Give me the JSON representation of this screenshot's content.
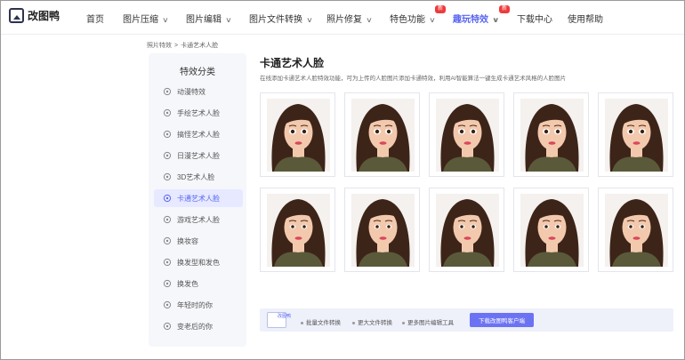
{
  "app": {
    "logo_text": "改图鸭"
  },
  "nav": {
    "home": "首页",
    "compress": "图片压缩",
    "edit": "图片编辑",
    "convert": "图片文件转换",
    "repair": "照片修复",
    "special": "特色功能",
    "fun": "趣玩特效",
    "download": "下载中心",
    "help": "使用帮助",
    "new_badge": "新"
  },
  "breadcrumb": {
    "parent": "照片特效",
    "separator": ">",
    "current": "卡通艺术人脸"
  },
  "sidebar": {
    "title": "特效分类",
    "items": [
      {
        "label": "动漫特效",
        "icon": "anime-icon"
      },
      {
        "label": "手绘艺术人脸",
        "icon": "sketch-face-icon"
      },
      {
        "label": "搞怪艺术人脸",
        "icon": "funny-face-icon"
      },
      {
        "label": "日漫艺术人脸",
        "icon": "japanese-anime-icon"
      },
      {
        "label": "3D艺术人脸",
        "icon": "3d-face-icon"
      },
      {
        "label": "卡通艺术人脸",
        "icon": "cartoon-face-icon",
        "active": true
      },
      {
        "label": "游戏艺术人脸",
        "icon": "game-face-icon"
      },
      {
        "label": "换妆容",
        "icon": "makeup-icon"
      },
      {
        "label": "换发型和发色",
        "icon": "hairstyle-icon"
      },
      {
        "label": "换发色",
        "icon": "hair-color-icon"
      },
      {
        "label": "年轻时的你",
        "icon": "younger-icon"
      },
      {
        "label": "变老后的你",
        "icon": "older-icon"
      }
    ]
  },
  "main": {
    "title": "卡通艺术人脸",
    "description": "在线添加卡通艺术人脸特效功能，可为上传的人脸图片添加卡通特效，利用AI智能算法一键生成卡通艺术风格的人脸图片"
  },
  "bottom_bar": {
    "icon_label": "改图鸭",
    "items": [
      "批量文件转换",
      "更大文件转换",
      "更多图片编辑工具"
    ],
    "button": "下载改图鸭客户端"
  },
  "colors": {
    "accent": "#5865f2",
    "badge": "#ef3a3a",
    "sidebar_bg": "#f6f7fb",
    "hair": "#3d2419",
    "skin": "#f3c9ae"
  }
}
